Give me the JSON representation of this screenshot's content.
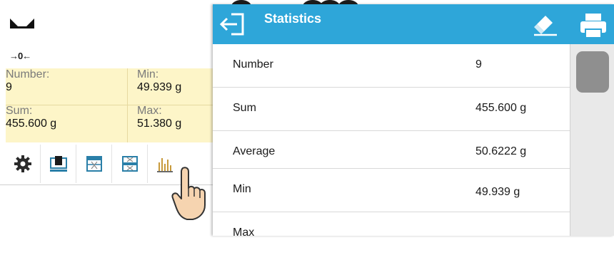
{
  "background": {
    "zero_indicator": "→0←",
    "info": {
      "number_label": "Number:",
      "number_value": "9",
      "min_label": "Min:",
      "min_value": "49.939 g",
      "sum_label": "Sum:",
      "sum_value": "455.600 g",
      "max_label": "Max:",
      "max_value": "51.380 g"
    },
    "toolbar": [
      "settings-icon",
      "tare-icon",
      "table-icon",
      "table-edit-icon",
      "statistics-icon"
    ]
  },
  "dialog": {
    "title": "Statistics",
    "rows": [
      {
        "name": "Number",
        "value": "9"
      },
      {
        "name": "Sum",
        "value": "455.600 g"
      },
      {
        "name": "Average",
        "value": "50.6222 g"
      },
      {
        "name": "Min",
        "value": "49.939 g"
      },
      {
        "name": "Max",
        "value": ""
      }
    ]
  },
  "colors": {
    "titlebar": "#2ea6d9",
    "info_panel": "#fdf5c8",
    "scroll_thumb": "#8f8f8f"
  }
}
